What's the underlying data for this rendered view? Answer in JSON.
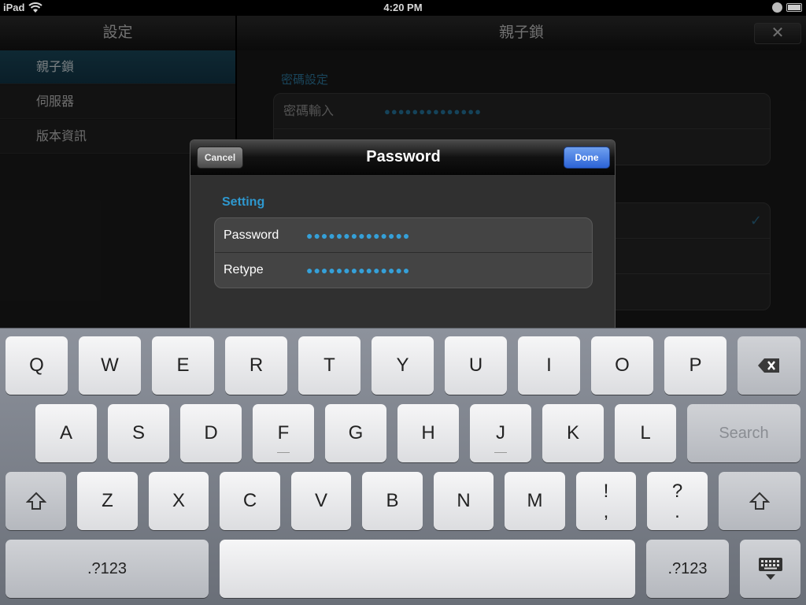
{
  "status": {
    "device": "iPad",
    "time": "4:20 PM"
  },
  "master": {
    "title": "設定",
    "items": [
      {
        "label": "親子鎖"
      },
      {
        "label": "伺服器"
      },
      {
        "label": "版本資訊"
      }
    ]
  },
  "detail": {
    "title": "親子鎖",
    "close_label": "✕",
    "section_title": "密碼設定",
    "password_row_label": "密碼輸入",
    "password_row_value": "●●●●●●●●●●●●●●",
    "check_mark": "✓"
  },
  "modal": {
    "title": "Password",
    "cancel_label": "Cancel",
    "done_label": "Done",
    "section": "Setting",
    "rows": [
      {
        "label": "Password",
        "value": "●●●●●●●●●●●●●●"
      },
      {
        "label": "Retype",
        "value": "●●●●●●●●●●●●●●"
      }
    ]
  },
  "keyboard": {
    "row1": [
      "Q",
      "W",
      "E",
      "R",
      "T",
      "Y",
      "U",
      "I",
      "O",
      "P"
    ],
    "row2": [
      "A",
      "S",
      "D",
      "F",
      "G",
      "H",
      "J",
      "K",
      "L"
    ],
    "row3": [
      "Z",
      "X",
      "C",
      "V",
      "B",
      "N",
      "M"
    ],
    "search_label": "Search",
    "exclaim_top": "!",
    "exclaim_bottom": ",",
    "question_top": "?",
    "question_bottom": ".",
    "numbers_label": ".?123",
    "icons": [
      "backspace-icon",
      "shift-icon",
      "keyboard-dismiss-icon"
    ]
  }
}
